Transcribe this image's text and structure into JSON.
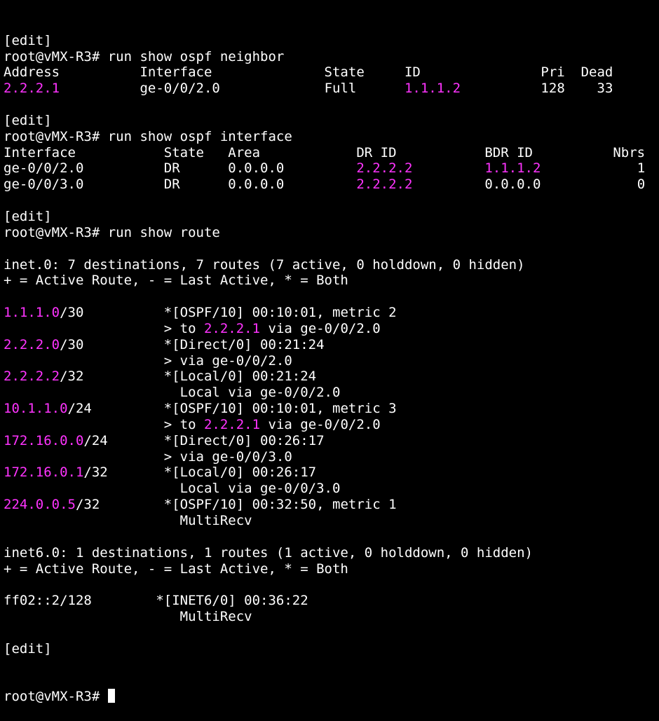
{
  "theme": {
    "background": "#000000",
    "foreground": "#ffffff",
    "highlight": "#ff33ff"
  },
  "terminal": {
    "lines": [
      [
        {
          "t": "[edit]"
        }
      ],
      [
        {
          "t": "root@vMX-R3# run show ospf neighbor"
        }
      ],
      [
        {
          "t": "Address          Interface              State     ID               Pri  Dead"
        }
      ],
      [
        {
          "t": "2.2.2.1",
          "h": true
        },
        {
          "t": "          ge-0/0/2.0             Full      "
        },
        {
          "t": "1.1.1.2",
          "h": true
        },
        {
          "t": "          128    33"
        }
      ],
      [
        {
          "t": ""
        }
      ],
      [
        {
          "t": "[edit]"
        }
      ],
      [
        {
          "t": "root@vMX-R3# run show ospf interface"
        }
      ],
      [
        {
          "t": "Interface           State   Area            DR ID           BDR ID          Nbrs"
        }
      ],
      [
        {
          "t": "ge-0/0/2.0          DR      0.0.0.0         "
        },
        {
          "t": "2.2.2.2",
          "h": true
        },
        {
          "t": "         "
        },
        {
          "t": "1.1.1.2",
          "h": true
        },
        {
          "t": "            1"
        }
      ],
      [
        {
          "t": "ge-0/0/3.0          DR      0.0.0.0         "
        },
        {
          "t": "2.2.2.2",
          "h": true
        },
        {
          "t": "         0.0.0.0            0"
        }
      ],
      [
        {
          "t": ""
        }
      ],
      [
        {
          "t": "[edit]"
        }
      ],
      [
        {
          "t": "root@vMX-R3# run show route"
        }
      ],
      [
        {
          "t": ""
        }
      ],
      [
        {
          "t": "inet.0: 7 destinations, 7 routes (7 active, 0 holddown, 0 hidden)"
        }
      ],
      [
        {
          "t": "+ = Active Route, - = Last Active, * = Both"
        }
      ],
      [
        {
          "t": ""
        }
      ],
      [
        {
          "t": "1.1.1.0",
          "h": true
        },
        {
          "t": "/30          *[OSPF/10] 00:10:01, metric 2"
        }
      ],
      [
        {
          "t": "                    > to "
        },
        {
          "t": "2.2.2.1",
          "h": true
        },
        {
          "t": " via ge-0/0/2.0"
        }
      ],
      [
        {
          "t": "2.2.2.0",
          "h": true
        },
        {
          "t": "/30          *[Direct/0] 00:21:24"
        }
      ],
      [
        {
          "t": "                    > via ge-0/0/2.0"
        }
      ],
      [
        {
          "t": "2.2.2.2",
          "h": true
        },
        {
          "t": "/32          *[Local/0] 00:21:24"
        }
      ],
      [
        {
          "t": "                      Local via ge-0/0/2.0"
        }
      ],
      [
        {
          "t": "10.1.1.0",
          "h": true
        },
        {
          "t": "/24         *[OSPF/10] 00:10:01, metric 3"
        }
      ],
      [
        {
          "t": "                    > to "
        },
        {
          "t": "2.2.2.1",
          "h": true
        },
        {
          "t": " via ge-0/0/2.0"
        }
      ],
      [
        {
          "t": "172.16.0.0",
          "h": true
        },
        {
          "t": "/24       *[Direct/0] 00:26:17"
        }
      ],
      [
        {
          "t": "                    > via ge-0/0/3.0"
        }
      ],
      [
        {
          "t": "172.16.0.1",
          "h": true
        },
        {
          "t": "/32       *[Local/0] 00:26:17"
        }
      ],
      [
        {
          "t": "                      Local via ge-0/0/3.0"
        }
      ],
      [
        {
          "t": "224.0.0.5",
          "h": true
        },
        {
          "t": "/32        *[OSPF/10] 00:32:50, metric 1"
        }
      ],
      [
        {
          "t": "                      MultiRecv"
        }
      ],
      [
        {
          "t": ""
        }
      ],
      [
        {
          "t": "inet6.0: 1 destinations, 1 routes (1 active, 0 holddown, 0 hidden)"
        }
      ],
      [
        {
          "t": "+ = Active Route, - = Last Active, * = Both"
        }
      ],
      [
        {
          "t": ""
        }
      ],
      [
        {
          "t": "ff02::2/128        *[INET6/0] 00:36:22"
        }
      ],
      [
        {
          "t": "                      MultiRecv"
        }
      ],
      [
        {
          "t": ""
        }
      ],
      [
        {
          "t": "[edit]"
        }
      ]
    ],
    "prompt": "root@vMX-R3# "
  }
}
